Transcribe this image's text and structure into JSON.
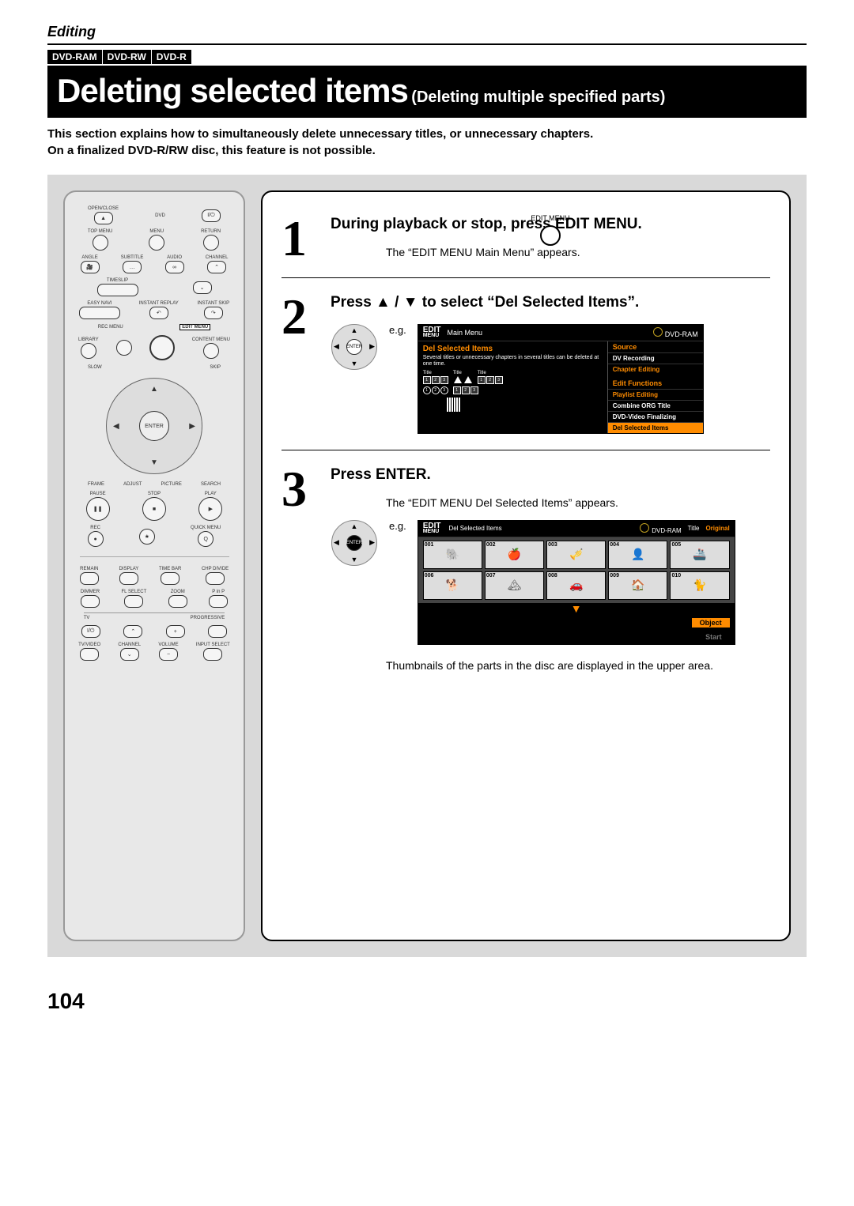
{
  "header": {
    "section": "Editing",
    "disc_tags": [
      "DVD-RAM",
      "DVD-RW",
      "DVD-R"
    ],
    "title_main": "Deleting selected items",
    "title_sub": "(Deleting multiple specified parts)",
    "intro_line1": "This section explains how to simultaneously delete unnecessary titles, or unnecessary chapters.",
    "intro_line2": "On a finalized DVD-R/RW disc, this feature is not possible."
  },
  "remote": {
    "open_close": "OPEN/CLOSE",
    "dvd": "DVD",
    "top_menu": "TOP MENU",
    "menu": "MENU",
    "return": "RETURN",
    "angle": "ANGLE",
    "subtitle": "SUBTITLE",
    "audio": "AUDIO",
    "channel": "CHANNEL",
    "timeslip": "TIMESLIP",
    "instant_replay": "INSTANT REPLAY",
    "instant_skip": "INSTANT SKIP",
    "easy_navi": "EASY NAVI",
    "rec_menu": "REC MENU",
    "edit_menu": "EDIT MENU",
    "library": "LIBRARY",
    "content_menu": "CONTENT MENU",
    "slow": "SLOW",
    "skip": "SKIP",
    "enter": "ENTER",
    "frame": "FRAME",
    "adjust": "ADJUST",
    "picture": "PICTURE",
    "search": "SEARCH",
    "pause": "PAUSE",
    "stop": "STOP",
    "play": "PLAY",
    "rec": "REC",
    "quick_menu": "QUICK MENU",
    "remain": "REMAIN",
    "display": "DISPLAY",
    "timebar": "TIME BAR",
    "chp_divide": "CHP DIVIDE",
    "dimmer": "DIMMER",
    "fl_select": "FL SELECT",
    "zoom": "ZOOM",
    "pinp": "P in P",
    "tv": "TV",
    "progressive": "PROGRESSIVE",
    "tv_video": "TV/VIDEO",
    "channel2": "CHANNEL",
    "volume": "VOLUME",
    "input_select": "INPUT SELECT"
  },
  "steps": [
    {
      "num": "1",
      "title": "During playback or stop, press EDIT MENU.",
      "desc": "The “EDIT MENU Main Menu” appears.",
      "icon_label": "EDIT MENU"
    },
    {
      "num": "2",
      "title": "Press ▲ / ▼ to select “Del Selected Items”.",
      "eg": "e.g.",
      "osd": {
        "logo_top": "EDIT",
        "logo_bot": "MENU",
        "header": "Main Menu",
        "disc": "DVD-RAM",
        "selected": "Del Selected Items",
        "desc": "Several titles or unnecessary chapters in several titles can be deleted at one time.",
        "thumb_labels": [
          "Title",
          "Title",
          "Title"
        ],
        "side_source_hdr": "Source",
        "side_source_items": [
          "DV Recording",
          "Chapter Editing"
        ],
        "side_func_hdr": "Edit Functions",
        "side_func_items": [
          "Playlist Editing",
          "Combine ORG Title",
          "DVD-Video Finalizing",
          "Del Selected Items"
        ]
      }
    },
    {
      "num": "3",
      "title": "Press ENTER.",
      "desc": "The “EDIT MENU Del Selected Items” appears.",
      "eg": "e.g.",
      "osd": {
        "logo_top": "EDIT",
        "logo_bot": "MENU",
        "header": "Del Selected Items",
        "disc": "DVD-RAM",
        "meta_title": "Title",
        "meta_orig": "Original",
        "thumb_nums": [
          "001",
          "002",
          "003",
          "004",
          "005",
          "006",
          "007",
          "008",
          "009",
          "010"
        ],
        "object": "Object",
        "start": "Start"
      },
      "foot": "Thumbnails of the parts in the disc are displayed in the upper area.",
      "dpad_center": "ENTER"
    }
  ],
  "page_number": "104"
}
